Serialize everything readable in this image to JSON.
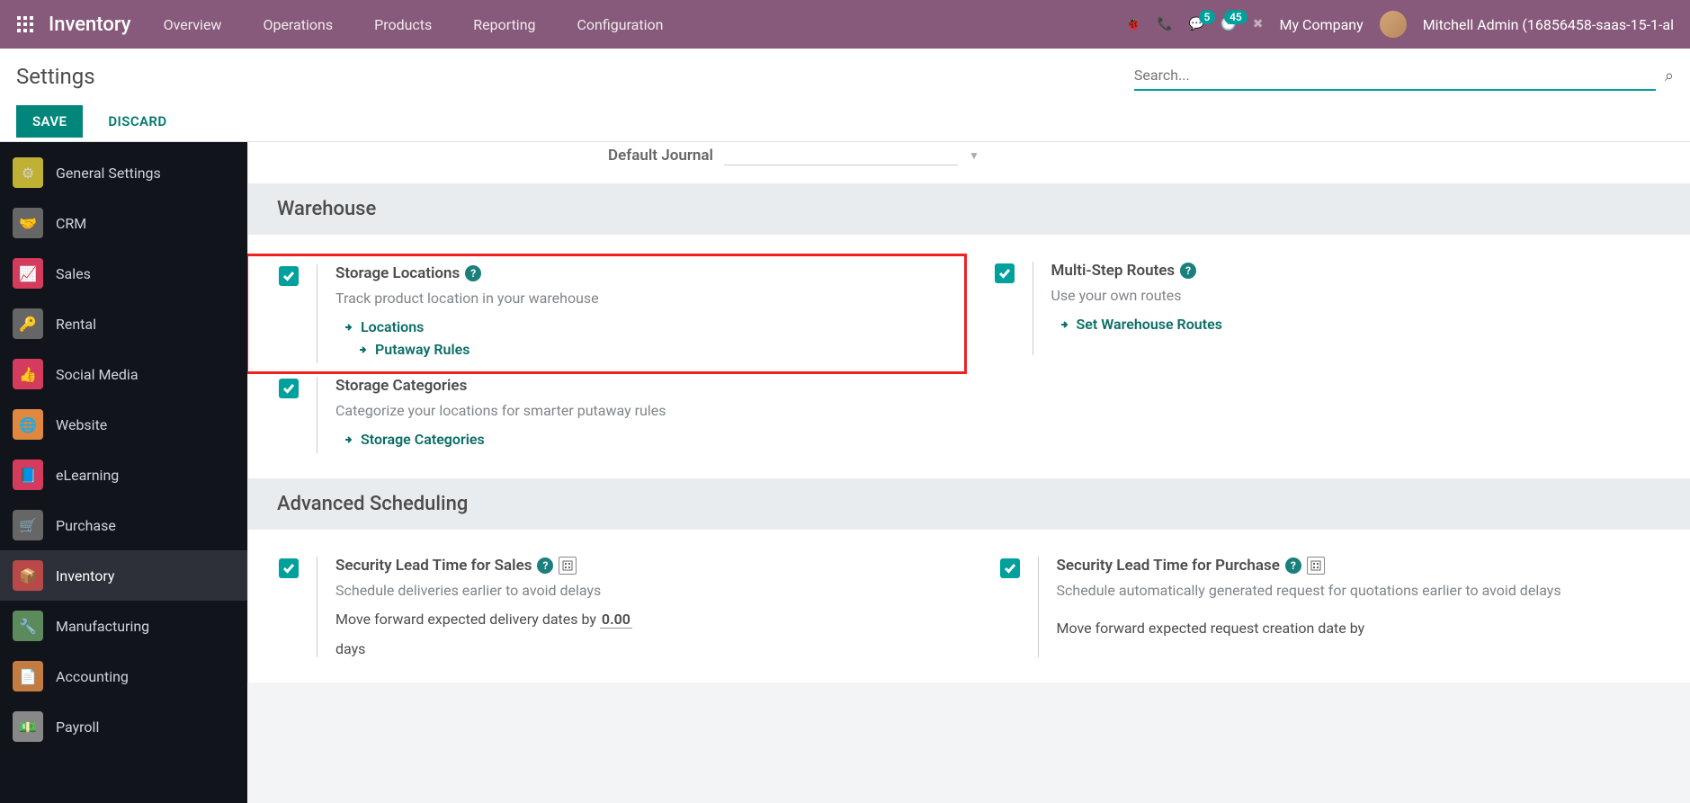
{
  "topbar": {
    "app_name": "Inventory",
    "menu": [
      "Overview",
      "Operations",
      "Products",
      "Reporting",
      "Configuration"
    ],
    "msg_count": "5",
    "clock_count": "45",
    "company": "My Company",
    "user": "Mitchell Admin (16856458-saas-15-1-al"
  },
  "subheader": {
    "title": "Settings",
    "search_placeholder": "Search...",
    "save": "SAVE",
    "discard": "DISCARD"
  },
  "sidebar": {
    "items": [
      {
        "label": "General Settings"
      },
      {
        "label": "CRM"
      },
      {
        "label": "Sales"
      },
      {
        "label": "Rental"
      },
      {
        "label": "Social Media"
      },
      {
        "label": "Website"
      },
      {
        "label": "eLearning"
      },
      {
        "label": "Purchase"
      },
      {
        "label": "Inventory"
      },
      {
        "label": "Manufacturing"
      },
      {
        "label": "Accounting"
      },
      {
        "label": "Payroll"
      }
    ]
  },
  "field_default_journal": "Default Journal",
  "section_warehouse": "Warehouse",
  "section_advanced": "Advanced Scheduling",
  "storage_locations": {
    "title": "Storage Locations",
    "desc": "Track product location in your warehouse",
    "link1": "Locations",
    "link2": "Putaway Rules"
  },
  "multi_step": {
    "title": "Multi-Step Routes",
    "desc": "Use your own routes",
    "link1": "Set Warehouse Routes"
  },
  "storage_cat": {
    "title": "Storage Categories",
    "desc": "Categorize your locations for smarter putaway rules",
    "link1": "Storage Categories"
  },
  "sec_sales": {
    "title": "Security Lead Time for Sales",
    "desc": "Schedule deliveries earlier to avoid delays",
    "extra_prefix": "Move forward expected delivery dates by ",
    "extra_value": "0.00",
    "extra_suffix": "days"
  },
  "sec_purchase": {
    "title": "Security Lead Time for Purchase",
    "desc": "Schedule automatically generated request for quotations earlier to avoid delays",
    "extra": "Move forward expected request creation date by"
  }
}
